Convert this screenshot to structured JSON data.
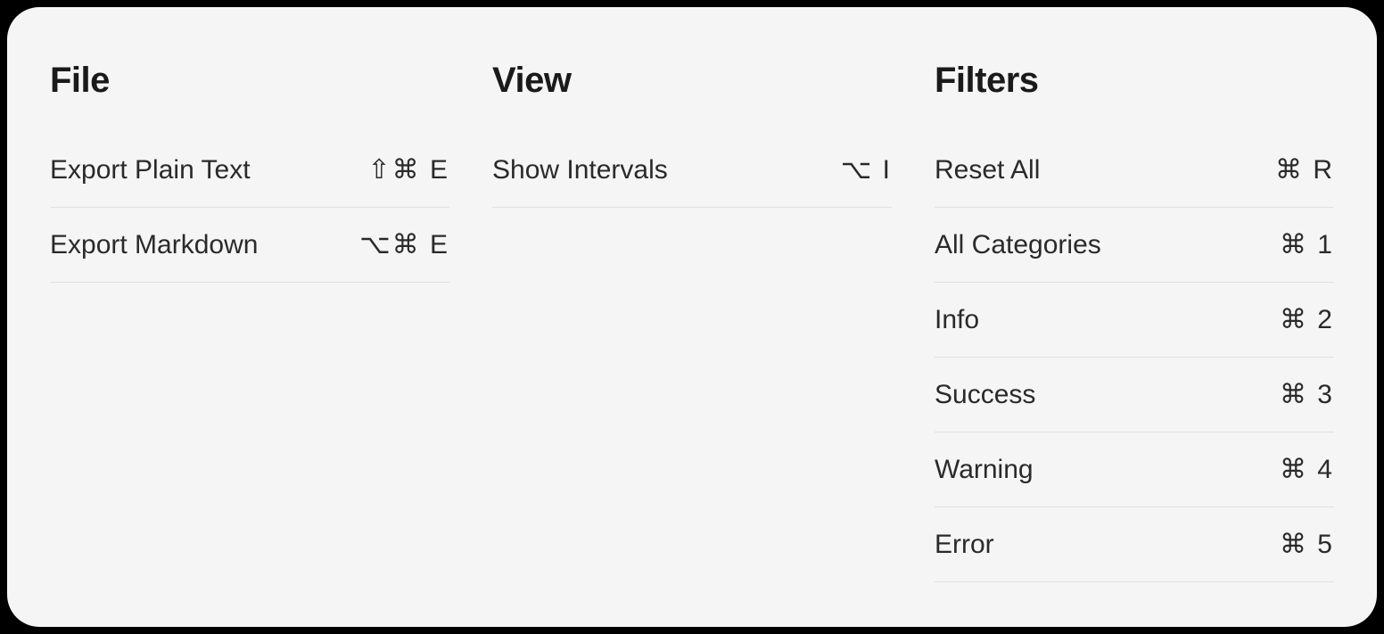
{
  "columns": [
    {
      "title": "File",
      "items": [
        {
          "name": "export-plain-text",
          "label": "Export Plain Text",
          "shortcut": "⇧⌘ E"
        },
        {
          "name": "export-markdown",
          "label": "Export Markdown",
          "shortcut": "⌥⌘ E"
        }
      ]
    },
    {
      "title": "View",
      "items": [
        {
          "name": "show-intervals",
          "label": "Show Intervals",
          "shortcut": "⌥  I"
        }
      ]
    },
    {
      "title": "Filters",
      "items": [
        {
          "name": "reset-all",
          "label": "Reset All",
          "shortcut": "⌘ R"
        },
        {
          "name": "all-categories",
          "label": "All Categories",
          "shortcut": "⌘ 1"
        },
        {
          "name": "info",
          "label": "Info",
          "shortcut": "⌘ 2"
        },
        {
          "name": "success",
          "label": "Success",
          "shortcut": "⌘ 3"
        },
        {
          "name": "warning",
          "label": "Warning",
          "shortcut": "⌘ 4"
        },
        {
          "name": "error",
          "label": "Error",
          "shortcut": "⌘ 5"
        }
      ]
    }
  ]
}
